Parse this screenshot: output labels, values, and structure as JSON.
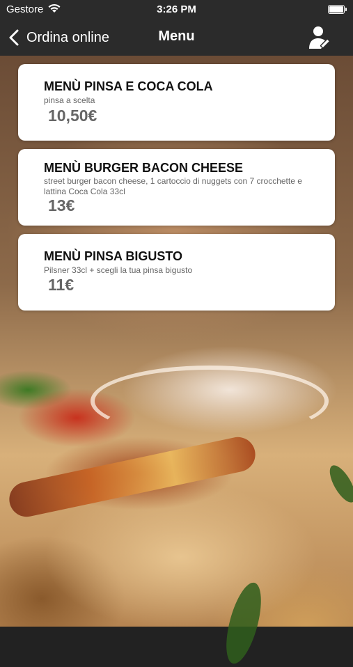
{
  "status_bar": {
    "carrier": "Gestore",
    "time": "3:26 PM",
    "wifi_icon": "wifi-icon",
    "battery_icon": "battery-icon"
  },
  "nav": {
    "back_label": "Ordina online",
    "title": "Menu",
    "back_icon": "chevron-left-icon",
    "user_icon": "user-edit-icon"
  },
  "menu_items": [
    {
      "title": "MENÙ PINSA E COCA COLA",
      "description": "pinsa a scelta",
      "price": "10,50€"
    },
    {
      "title": "MENÙ BURGER BACON CHEESE",
      "description": "street burger bacon cheese, 1 cartoccio di nuggets con 7 crocchette e lattina Coca Cola 33cl",
      "price": "13€"
    },
    {
      "title": "MENÙ PINSA BIGUSTO",
      "description": "Pilsner  33cl + scegli la tua pinsa bigusto",
      "price": "11€"
    }
  ],
  "colors": {
    "bar_background": "#2b2b2b",
    "card_background": "#ffffff",
    "price_text": "#666666"
  }
}
